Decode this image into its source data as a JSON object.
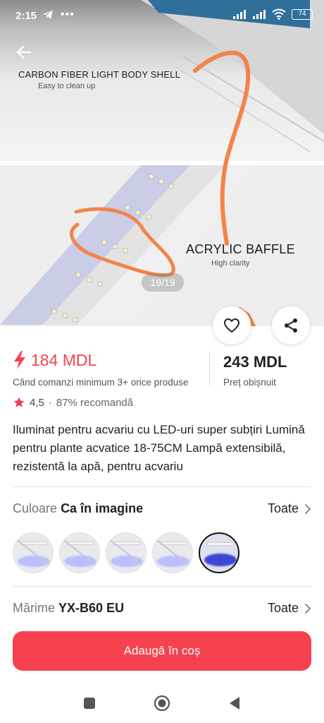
{
  "status_bar": {
    "time": "2:15",
    "battery": "74"
  },
  "hero": {
    "top_caption": "CARBON FIBER LIGHT BODY SHELL",
    "top_subcaption": "Easy to clean up",
    "bottom_caption": "ACRYLIC BAFFLE",
    "bottom_subcaption": "High clarity",
    "image_counter": "19/19"
  },
  "icons": {
    "back": "arrow-left-icon",
    "favorite": "heart-icon",
    "share": "share-icon",
    "flash": "lightning-icon",
    "star": "star-icon",
    "chevron": "chevron-right-icon"
  },
  "price": {
    "sale_value": "184 MDL",
    "sale_note": "Când comanzi minimum 3+ orice produse",
    "regular_value": "243 MDL",
    "regular_label": "Preț obișnuit"
  },
  "rating": {
    "value": "4,5",
    "separator": "·",
    "recommend": "87% recomandă"
  },
  "product_title": "Iluminat pentru acvariu cu LED-uri super subțiri Lumină pentru plante acvatice 18-75CM Lampă extensibilă, rezistentă la apă, pentru acvariu",
  "color_option": {
    "label": "Culoare",
    "value": "Ca în imagine",
    "all_label": "Toate"
  },
  "swatches_count": 5,
  "size_option": {
    "label": "Mărime",
    "value": "YX-B60 EU",
    "all_label": "Toate"
  },
  "cta_label": "Adaugă în coș",
  "colors": {
    "accent": "#f5424e",
    "annotation": "#f4834a",
    "selected_glow": "#3f46d6"
  }
}
